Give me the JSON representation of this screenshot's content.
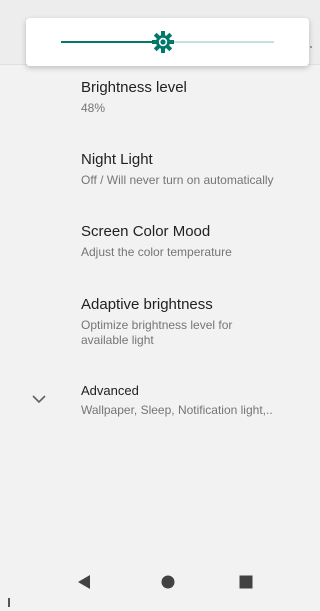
{
  "brightness_slider": {
    "level_fraction": 0.48,
    "accent_color": "#00796b",
    "track_color": "#c5e0df",
    "thumb_icon": "brightness-icon"
  },
  "settings": [
    {
      "title": "Brightness level",
      "summary": "48%"
    },
    {
      "title": "Night Light",
      "summary": "Off / Will never turn on automatically"
    },
    {
      "title": "Screen Color Mood",
      "summary": "Adjust the color temperature"
    },
    {
      "title": "Adaptive brightness",
      "summary": "Optimize brightness level for available light"
    }
  ],
  "advanced": {
    "title": "Advanced",
    "summary": "Wallpaper, Sleep, Notification light,..",
    "icon": "chevron-down-icon"
  },
  "nav_bar": {
    "back_icon": "back-icon",
    "home_icon": "home-icon",
    "recents_icon": "recents-icon"
  }
}
